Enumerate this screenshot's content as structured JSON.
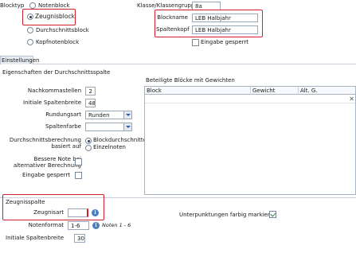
{
  "blocktyp": {
    "label": "Blocktyp",
    "options": [
      "Notenblock",
      "Zeugnisblock",
      "Durchschnittsblock",
      "Kopfnotenblock"
    ],
    "selected": 1
  },
  "klasse": {
    "label": "Klasse/Klassengruppe",
    "value": "8a"
  },
  "blockname": {
    "label": "Blockname",
    "value": "LEB Halbjahr"
  },
  "spaltenkopf": {
    "label": "Spaltenkopf",
    "value": "LEB Halbjahr"
  },
  "eingabe_gesperrt_top": {
    "label": "Eingabe gesperrt",
    "checked": false
  },
  "tab": {
    "label": "Einstellungen"
  },
  "section": {
    "title": "Eigenschaften der Durchschnittsspalte"
  },
  "nachkommastellen": {
    "label": "Nachkommastellen",
    "value": "2"
  },
  "initiale_spaltenbreite": {
    "label": "Initiale Spaltenbreite",
    "value": "48"
  },
  "rundungsart": {
    "label": "Rundungsart",
    "value": "Runden"
  },
  "spaltenfarbe": {
    "label": "Spaltenfarbe",
    "value": ""
  },
  "berechnung": {
    "label_line1": "Durchschnittsberechnung",
    "label_line2": "basiert auf",
    "options": [
      "Blockdurchschnitten",
      "Einzelnoten"
    ],
    "selected": 0
  },
  "bessere_note": {
    "label_line1": "Bessere Note bei",
    "label_line2": "alternativer Berechnung",
    "checked": false
  },
  "eingabe_gesperrt_mid": {
    "label": "Eingabe gesperrt",
    "checked": false
  },
  "bloecke": {
    "title": "Beteiligte Blöcke mit Gewichten",
    "columns": [
      "Block",
      "Gewicht",
      "Alt. G."
    ],
    "close_glyph": "✕"
  },
  "zeugnisspalte": {
    "title": "Zeugnisspalte",
    "zeugnisart_label": "Zeugnisart",
    "zeugnisart_value": "",
    "notenformat_label": "Notenformat",
    "notenformat_value": "1-6",
    "notenformat_hint": "Noten 1 - 6",
    "spaltenbreite_label": "Initiale Spaltenbreite",
    "spaltenbreite_value": "30",
    "info_glyph": "i"
  },
  "unterpunktungen": {
    "label": "Unterpunktungen farbig markieren",
    "checked": true
  }
}
